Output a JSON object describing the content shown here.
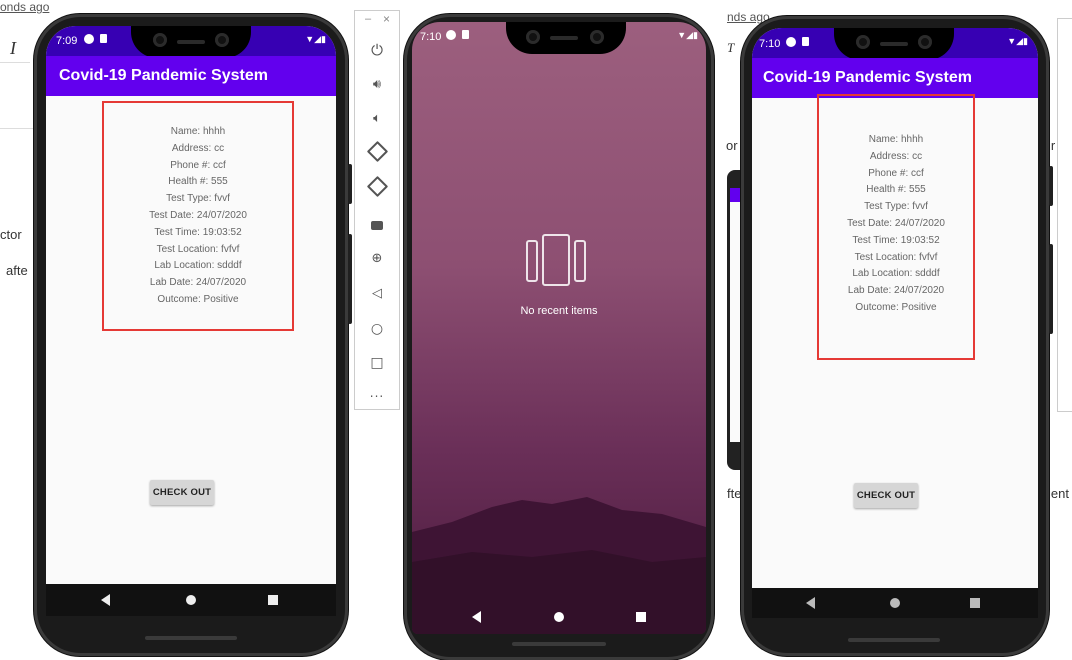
{
  "background": {
    "fragments_left": [
      "onds ago",
      "I",
      "ctor",
      "afte"
    ],
    "fragments_mid": [
      "or",
      "fte"
    ],
    "fragments_right": [
      "nds ago",
      "T",
      "ir",
      "ient"
    ]
  },
  "phone1": {
    "time": "7:09",
    "app_title": "Covid-19 Pandemic System",
    "record": {
      "name": "Name: hhhh",
      "address": "Address: cc",
      "phone": "Phone #: ccf",
      "health": "Health #: 555",
      "test_type": "Test Type: fvvf",
      "test_date": "Test Date: 24/07/2020",
      "test_time": "Test Time: 19:03:52",
      "test_location": "Test Location: fvfvf",
      "lab_location": "Lab Location: sdddf",
      "lab_date": "Lab Date: 24/07/2020",
      "outcome": "Outcome: Positive"
    },
    "checkout_label": "CHECK OUT"
  },
  "phone2": {
    "time": "7:10",
    "recents_message": "No recent items"
  },
  "phone3": {
    "time": "7:10",
    "app_title": "Covid-19 Pandemic System",
    "record": {
      "name": "Name: hhhh",
      "address": "Address: cc",
      "phone": "Phone #: ccf",
      "health": "Health #: 555",
      "test_type": "Test Type: fvvf",
      "test_date": "Test Date: 24/07/2020",
      "test_time": "Test Time: 19:03:52",
      "test_location": "Test Location: fvfvf",
      "lab_location": "Lab Location: sdddf",
      "lab_date": "Lab Date: 24/07/2020",
      "outcome": "Outcome: Positive"
    },
    "checkout_label": "CHECK OUT"
  },
  "emulator_toolbar": {
    "window_buttons": [
      "–",
      "×"
    ],
    "tools": [
      "power-icon",
      "volume-up-icon",
      "volume-down-icon",
      "rotate-left-icon",
      "rotate-right-icon",
      "camera-icon",
      "zoom-icon",
      "back-icon",
      "home-icon",
      "overview-icon",
      "more-icon"
    ],
    "more_label": "..."
  },
  "colors": {
    "app_bar": "#6200ee",
    "highlight_box": "#e53935",
    "screen_background": "#fafafa",
    "recents_top": "#9c5f7e",
    "recents_bottom": "#4a1a3c"
  }
}
